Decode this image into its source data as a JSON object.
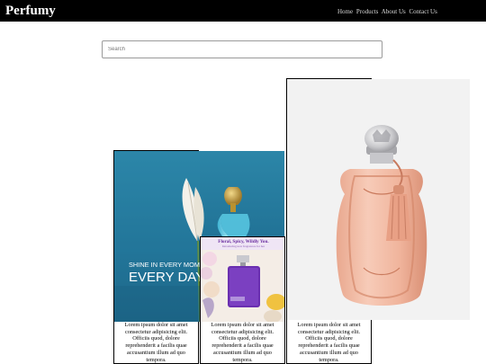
{
  "nav": {
    "brand": "Perfumy",
    "links": [
      "Home",
      "Products",
      "About Us",
      "Contact Us"
    ]
  },
  "search": {
    "placeholder": "Search"
  },
  "cards": [
    {
      "image_text_line1": "SHINE IN EVERY MOMENT",
      "image_text_line2": "EVERY DAY",
      "description": "Lorem ipsum dolor sit amet consectetur adipisicing elit. Officiis quod, dolore reprehenderit a facilis quae accusantium illum ad quo tempora."
    },
    {
      "image_text_line1": "Floral, Spicy, Wildly You.",
      "image_text_line2": "Introducing new fragrances for her",
      "description": "Lorem ipsum dolor sit amet consectetur adipisicing elit. Officiis quod, dolore reprehenderit a facilis quae accusantium illum ad quo tempora."
    },
    {
      "description": "Lorem ipsum dolor sit amet consectetur adipisicing elit. Officiis quod, dolore reprehenderit a facilis quae accusantium illum ad quo tempora."
    }
  ]
}
